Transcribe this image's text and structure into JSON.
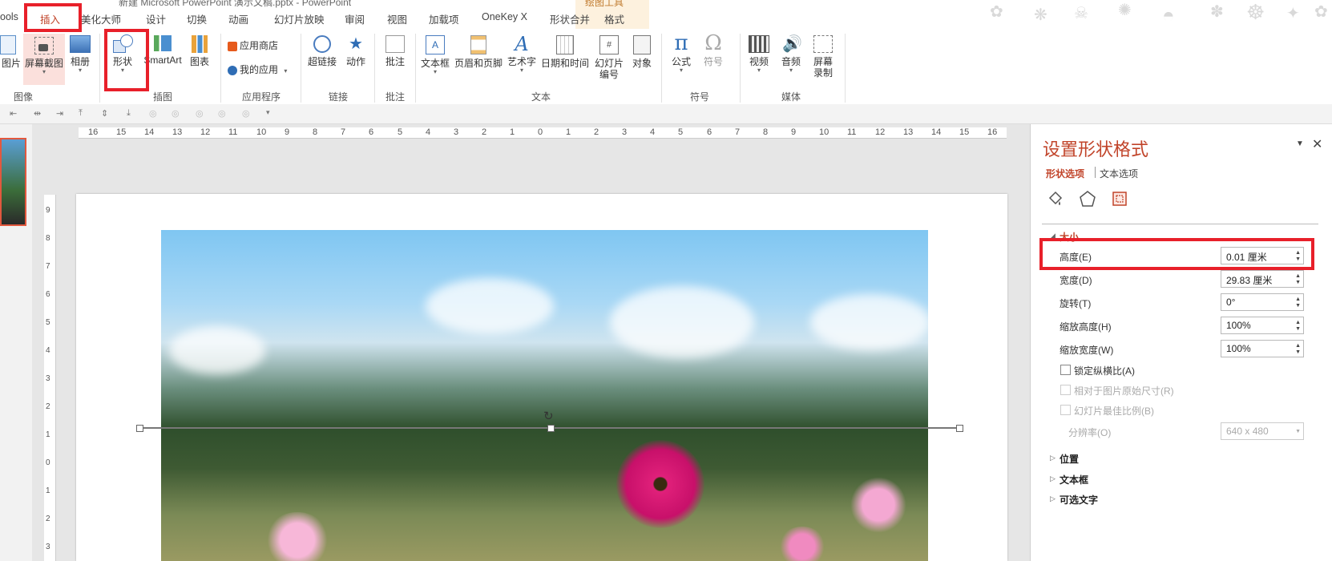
{
  "window": {
    "title": "新建 Microsoft PowerPoint 演示文稿.pptx - PowerPoint",
    "context_tab": "绘图工具"
  },
  "tabs": [
    "ools",
    "插入",
    "美化大师",
    "设计",
    "切换",
    "动画",
    "幻灯片放映",
    "审阅",
    "视图",
    "加载项",
    "OneKey X",
    "形状合并",
    "格式"
  ],
  "ribbon": {
    "images": {
      "picture": "图片",
      "screenshot": "屏幕截图",
      "album": "相册",
      "group": "图像"
    },
    "illustrations": {
      "shapes": "形状",
      "smartart": "SmartArt",
      "chart": "图表",
      "group": "插图"
    },
    "apps": {
      "store": "应用商店",
      "myapps": "我的应用",
      "group": "应用程序"
    },
    "links": {
      "hyperlink": "超链接",
      "action": "动作",
      "group": "链接"
    },
    "comments": {
      "comment": "批注",
      "group": "批注"
    },
    "text": {
      "textbox": "文本框",
      "headerfooter": "页眉和页脚",
      "wordart": "艺术字",
      "datetime": "日期和时间",
      "slidenum_1": "幻灯片",
      "slidenum_2": "编号",
      "object": "对象",
      "group": "文本"
    },
    "symbols": {
      "equation": "公式",
      "symbol": "符号",
      "group": "符号"
    },
    "media": {
      "video": "视频",
      "audio": "音频",
      "screenrec_1": "屏幕",
      "screenrec_2": "录制",
      "group": "媒体"
    }
  },
  "ruler": {
    "h_ticks": [
      "16",
      "15",
      "14",
      "13",
      "12",
      "11",
      "10",
      "9",
      "8",
      "7",
      "6",
      "5",
      "4",
      "3",
      "2",
      "1",
      "0",
      "1",
      "2",
      "3",
      "4",
      "5",
      "6",
      "7",
      "8",
      "9",
      "10",
      "11",
      "12",
      "13",
      "14",
      "15",
      "16"
    ],
    "v_ticks": [
      "9",
      "8",
      "7",
      "6",
      "5",
      "4",
      "3",
      "2",
      "1",
      "0",
      "1",
      "2",
      "3"
    ]
  },
  "pane": {
    "title": "设置形状格式",
    "tab_shape": "形状选项",
    "tab_text": "文本选项",
    "section_size": "大小",
    "fields": [
      {
        "label": "高度(E)",
        "value": "0.01 厘米"
      },
      {
        "label": "宽度(D)",
        "value": "29.83 厘米"
      },
      {
        "label": "旋转(T)",
        "value": "0°"
      },
      {
        "label": "缩放高度(H)",
        "value": "100%"
      },
      {
        "label": "缩放宽度(W)",
        "value": "100%"
      }
    ],
    "lock_ratio": "锁定纵横比(A)",
    "relative_original": "相对于图片原始尺寸(R)",
    "best_scale": "幻灯片最佳比例(B)",
    "resolution_label": "分辨率(O)",
    "resolution_value": "640 x 480",
    "sections": [
      "位置",
      "文本框",
      "可选文字"
    ]
  },
  "colors": {
    "accent": "#c1442a",
    "highlight": "#e8202a"
  }
}
